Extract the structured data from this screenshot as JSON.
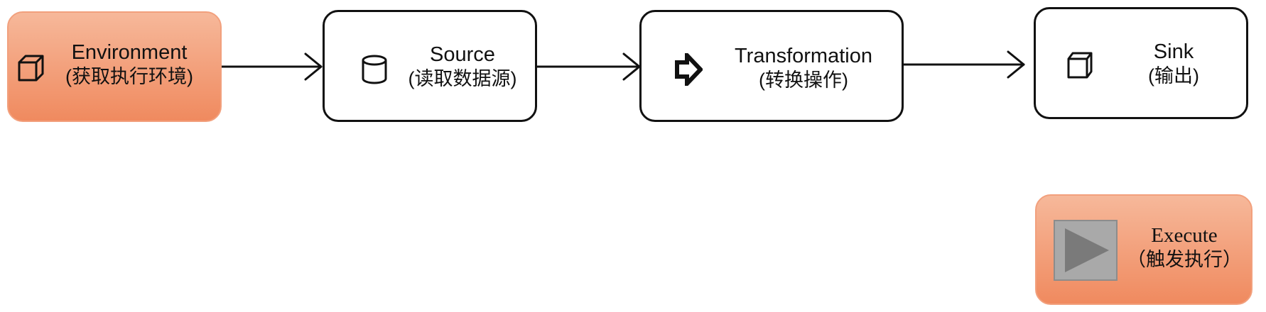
{
  "nodes": {
    "environment": {
      "title": "Environment",
      "subtitle": "(获取执行环境)",
      "icon": "cube-icon"
    },
    "source": {
      "title": "Source",
      "subtitle": "(读取数据源)",
      "icon": "database-icon"
    },
    "transformation": {
      "title": "Transformation",
      "subtitle": "(转换操作)",
      "icon": "arrow-right-icon"
    },
    "sink": {
      "title": "Sink",
      "subtitle": "(输出)",
      "icon": "cube-icon"
    },
    "execute": {
      "title": "Execute",
      "subtitle": "（触发执行）",
      "icon": "play-icon"
    }
  },
  "colors": {
    "highlight_fill": "#f08a5f",
    "highlight_border": "#f2a07d",
    "stroke": "#111111",
    "play_gray": "#a9a9a9"
  }
}
